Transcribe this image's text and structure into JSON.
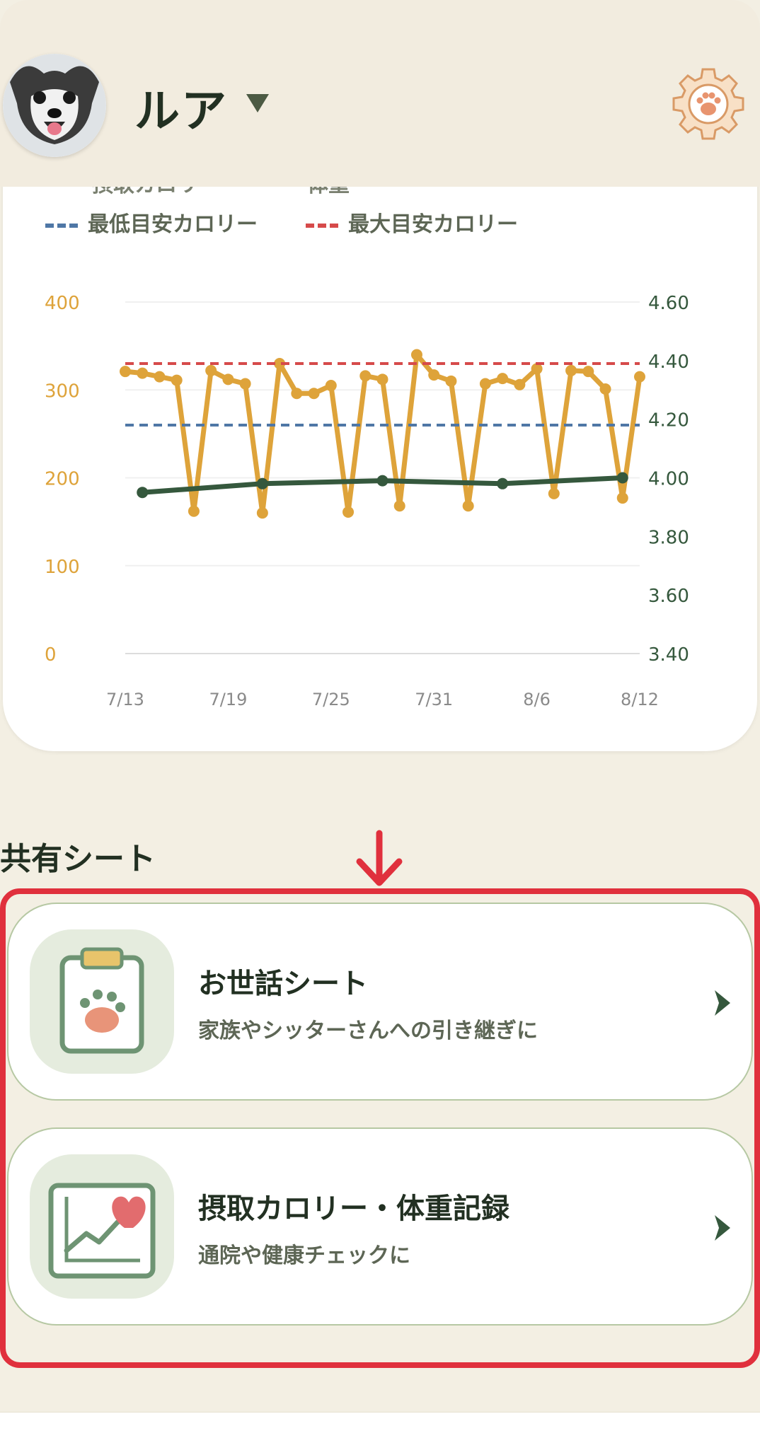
{
  "header": {
    "pet_name": "ルア",
    "avatar_alt": "ペットの写真",
    "settings_icon": "gear-paw-icon",
    "dropdown_icon": "caret-down-icon"
  },
  "chart_legend": {
    "partial_label_1": "摂取カロリー",
    "partial_label_2": "体重",
    "min_label": "最低目安カロリー",
    "max_label": "最大目安カロリー",
    "min_color": "#4f77a6",
    "max_color": "#d64a4a"
  },
  "chart_data": {
    "type": "line",
    "x": [
      "7/13",
      "7/14",
      "7/15",
      "7/16",
      "7/17",
      "7/18",
      "7/19",
      "7/20",
      "7/21",
      "7/22",
      "7/23",
      "7/24",
      "7/25",
      "7/26",
      "7/27",
      "7/28",
      "7/29",
      "7/30",
      "7/31",
      "8/1",
      "8/2",
      "8/3",
      "8/4",
      "8/5",
      "8/6",
      "8/7",
      "8/8",
      "8/9",
      "8/10",
      "8/11",
      "8/12"
    ],
    "x_ticks": [
      "7/13",
      "7/19",
      "7/25",
      "7/31",
      "8/6",
      "8/12"
    ],
    "left_axis": {
      "ticks": [
        "0",
        "100",
        "200",
        "300",
        "400"
      ],
      "ylim": [
        0,
        400
      ],
      "color": "#dea33a"
    },
    "right_axis": {
      "ticks": [
        "3.40",
        "3.60",
        "3.80",
        "4.00",
        "4.20",
        "4.40",
        "4.60"
      ],
      "ylim": [
        3.4,
        4.6
      ],
      "color": "#35583d"
    },
    "series": [
      {
        "name": "摂取カロリー",
        "axis": "left",
        "color": "#dea33a",
        "values": [
          321,
          319,
          315,
          311,
          162,
          322,
          312,
          307,
          160,
          330,
          296,
          296,
          305,
          161,
          316,
          312,
          168,
          340,
          317,
          310,
          168,
          307,
          313,
          306,
          324,
          182,
          322,
          321,
          301,
          177,
          315
        ]
      },
      {
        "name": "体重",
        "axis": "right",
        "color": "#35583d",
        "points": [
          {
            "x": "7/14",
            "y": 3.95
          },
          {
            "x": "7/21",
            "y": 3.98
          },
          {
            "x": "7/28",
            "y": 3.99
          },
          {
            "x": "8/4",
            "y": 3.98
          },
          {
            "x": "8/11",
            "y": 4.0
          }
        ]
      },
      {
        "name": "最低目安カロリー",
        "axis": "left",
        "color": "#4f77a6",
        "style": "dashed",
        "constant": 260
      },
      {
        "name": "最大目安カロリー",
        "axis": "left",
        "color": "#d64a4a",
        "style": "dashed",
        "constant": 330
      }
    ]
  },
  "shared": {
    "title": "共有シート",
    "cards": [
      {
        "title": "お世話シート",
        "subtitle": "家族やシッターさんへの引き継ぎに",
        "icon": "clipboard-paw-icon",
        "chevron": "›"
      },
      {
        "title": "摂取カロリー・体重記録",
        "subtitle": "通院や健康チェックに",
        "icon": "chart-heart-icon",
        "chevron": "›"
      }
    ]
  },
  "colors": {
    "background": "#f3efe3",
    "dark_green": "#223022",
    "highlight_red": "#e0303d"
  }
}
